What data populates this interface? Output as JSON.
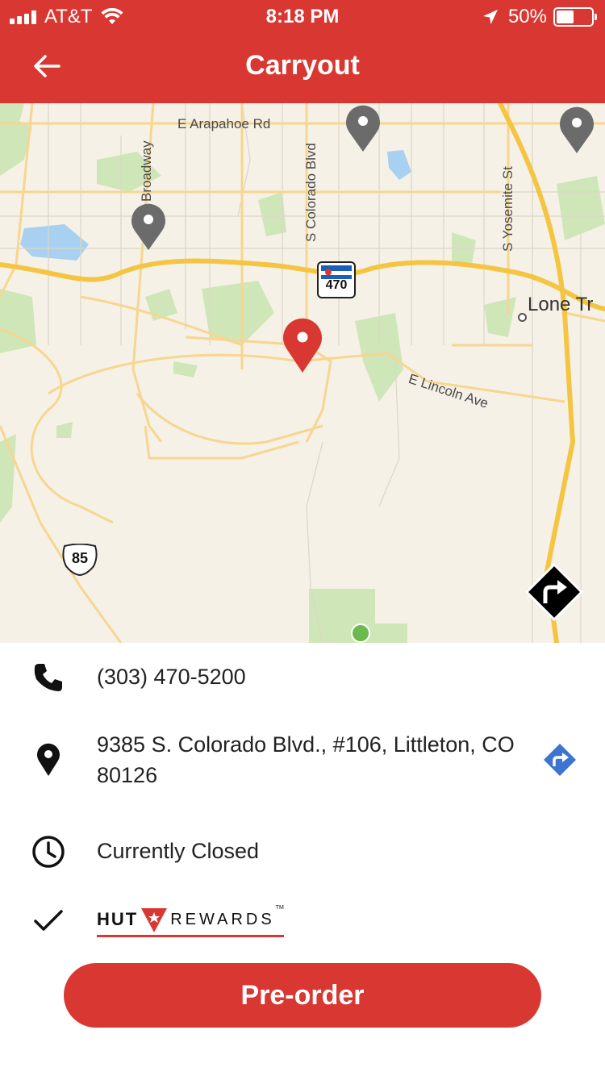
{
  "status_bar": {
    "carrier": "AT&T",
    "time": "8:18 PM",
    "battery_text": "50%",
    "battery_level": 0.5,
    "icons": [
      "signal-icon",
      "wifi-icon",
      "location-arrow-icon",
      "battery-icon"
    ]
  },
  "header": {
    "title": "Carryout",
    "back_icon": "arrow-left-icon",
    "background_color": "#d93731"
  },
  "map": {
    "street_labels": {
      "arapahoe": "E Arapahoe Rd",
      "broadway": "Broadway",
      "colorado_blvd": "S Colorado Blvd",
      "yosemite": "S Yosemite St",
      "lincoln": "E Lincoln Ave",
      "lone_tree": "Lone Tr"
    },
    "shields": {
      "i470": "470",
      "us85": "85"
    },
    "pins": [
      {
        "name": "store-pin-1",
        "selected": false
      },
      {
        "name": "store-pin-2",
        "selected": false
      },
      {
        "name": "store-pin-3",
        "selected": false
      },
      {
        "name": "selected-store-pin",
        "selected": true
      }
    ],
    "directions_icon": "directions-icon"
  },
  "store": {
    "phone": "(303) 470-5200",
    "address": "9385 S. Colorado Blvd., #106, Littleton, CO 80126",
    "hours_status": "Currently Closed",
    "rewards_badge": {
      "word1": "HUT",
      "word2": "REWARDS",
      "trademark": "TM",
      "check_icon": "check-icon"
    }
  },
  "actions": {
    "preorder_label": "Pre-order"
  },
  "colors": {
    "accent": "#d93731",
    "directions_blue": "#3d74d1",
    "pin_gray": "#6b6b6b"
  }
}
